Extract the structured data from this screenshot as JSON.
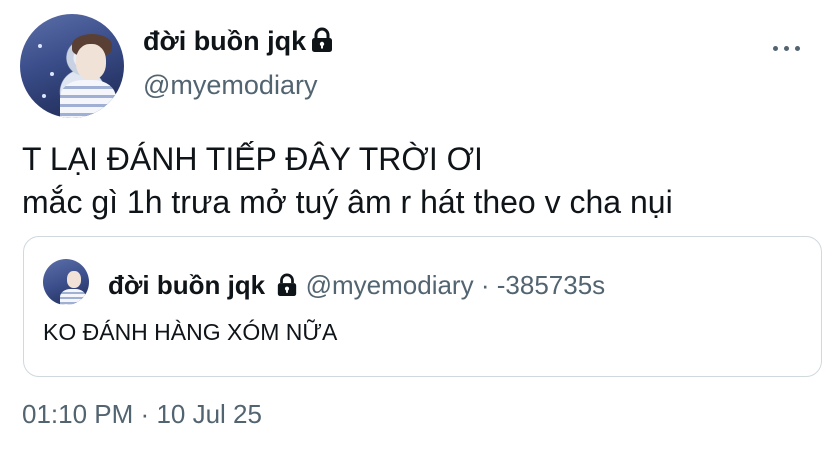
{
  "author": {
    "display_name": "đời buồn jqk",
    "handle": "@myemodiary",
    "protected_icon": "lock-icon"
  },
  "menu_icon": "more-horizontal-icon",
  "tweet": {
    "lines": [
      "T LẠI ĐÁNH TIẾP ĐÂY TRỜI ƠI",
      "mắc gì 1h trưa mở tuý âm r hát theo v cha nụi"
    ]
  },
  "quoted": {
    "display_name": "đời buồn jqk",
    "handle": "@myemodiary",
    "separator": "·",
    "time": "-385735s",
    "text": "KO ĐÁNH HÀNG XÓM NỮA"
  },
  "timestamp": {
    "time": "01:10 PM",
    "separator": "·",
    "date": "10 Jul 25"
  },
  "colors": {
    "text_primary": "#0f1419",
    "text_secondary": "#536471",
    "border": "#cfd9de"
  }
}
